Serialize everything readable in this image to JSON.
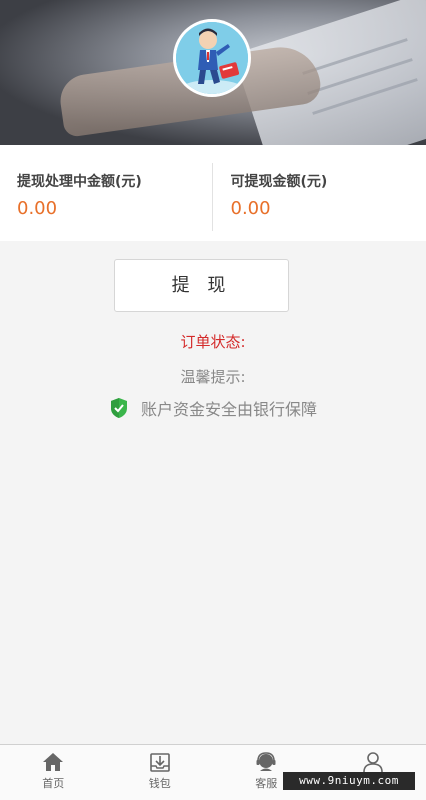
{
  "amounts": {
    "processing": {
      "label": "提现处理中金额(元)",
      "value": "0.00"
    },
    "available": {
      "label": "可提现金额(元)",
      "value": "0.00"
    }
  },
  "withdraw_button": "提 现",
  "order_status": "订单状态:",
  "tip": "温馨提示:",
  "security_notice": {
    "icon": "shield-check-icon",
    "text": "账户资金安全由银行保障"
  },
  "tabbar": [
    {
      "icon": "home-icon",
      "label": "首页"
    },
    {
      "icon": "wallet-download-icon",
      "label": "钱包"
    },
    {
      "icon": "customer-service-icon",
      "label": "客服"
    },
    {
      "icon": "user-icon",
      "label": ""
    }
  ],
  "watermark": "www.9niuym.com",
  "colors": {
    "amount": "#e8702a",
    "order_status": "#d42a2a",
    "shield": "#3ab54a"
  }
}
